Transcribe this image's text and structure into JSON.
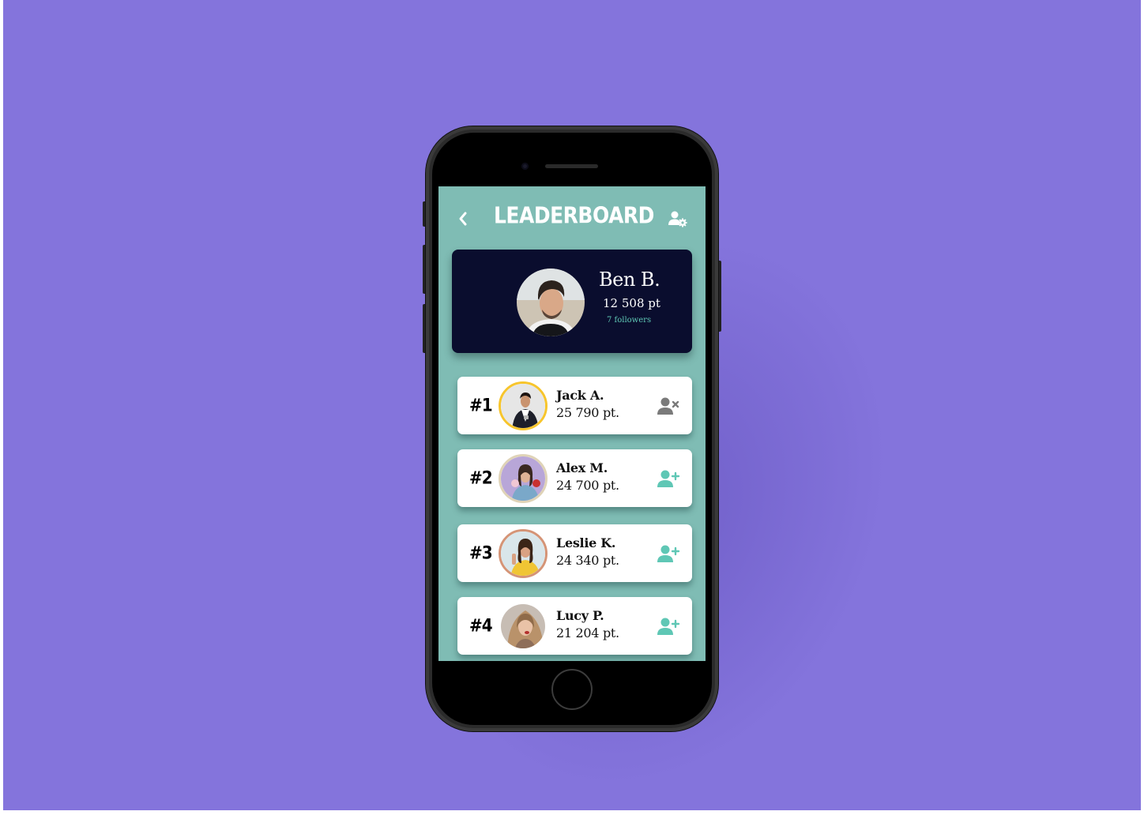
{
  "header": {
    "title": "LEADERBOARD",
    "back_icon": "chevron-left-icon",
    "settings_icon": "user-settings-icon"
  },
  "profile": {
    "name": "Ben B.",
    "points": "12 508 pt",
    "followers": "7 followers"
  },
  "leaderboard": [
    {
      "rank": "#1",
      "name": "Jack A.",
      "points": "25 790 pt.",
      "action_icon": "remove-friend-icon",
      "ring_color": "#f7c52c"
    },
    {
      "rank": "#2",
      "name": "Alex M.",
      "points": "24 700 pt.",
      "action_icon": "add-friend-icon",
      "ring_color": "#dfd3b7"
    },
    {
      "rank": "#3",
      "name": "Leslie K.",
      "points": "24 340 pt.",
      "action_icon": "add-friend-icon",
      "ring_color": "#d59476"
    },
    {
      "rank": "#4",
      "name": "Lucy P.",
      "points": "21 204 pt.",
      "action_icon": "add-friend-icon",
      "ring_color": "#ffffff"
    }
  ],
  "colors": {
    "background": "#8474dc",
    "screen": "#7fbcb4",
    "profile_card": "#0a0d2e",
    "accent": "#5fc7b5",
    "remove_icon": "#7a7a7a"
  }
}
